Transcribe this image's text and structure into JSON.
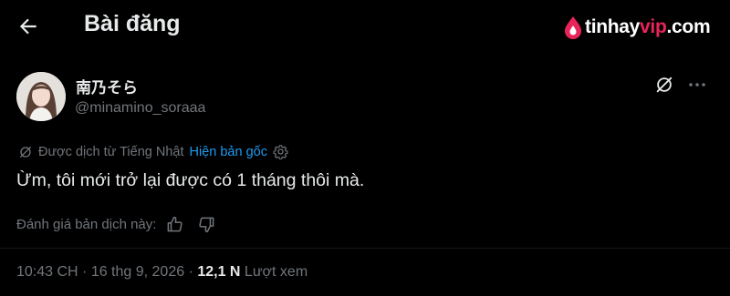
{
  "header": {
    "title": "Bài đăng",
    "back_icon": "arrow-left-icon"
  },
  "watermark": {
    "prefix": "tinhay",
    "accent": "vip",
    "suffix": ".com",
    "accent_color": "#e8245a"
  },
  "author": {
    "display_name": "南乃そら",
    "handle": "@minamino_soraaa",
    "avatar": "avatar-photo"
  },
  "actions": {
    "grok_icon": "grok-icon",
    "more_icon": "more-horizontal-icon"
  },
  "translation": {
    "translated_from": "Được dịch từ Tiếng Nhật",
    "show_original": "Hiện bản gốc",
    "link_color": "#1d9bf0"
  },
  "post": {
    "text": "Ừm, tôi mới trở lại được có 1 tháng thôi mà."
  },
  "rating": {
    "prompt": "Đánh giá bản dịch này:"
  },
  "meta": {
    "time": "10:43 CH",
    "separator1": " · ",
    "date": "16 thg 9, 2026",
    "separator2": " · ",
    "views_count": "12,1 N",
    "views_label": " Lượt xem"
  },
  "colors": {
    "background": "#000000",
    "primary_text": "#e7e9ea",
    "secondary_text": "#71767b"
  }
}
